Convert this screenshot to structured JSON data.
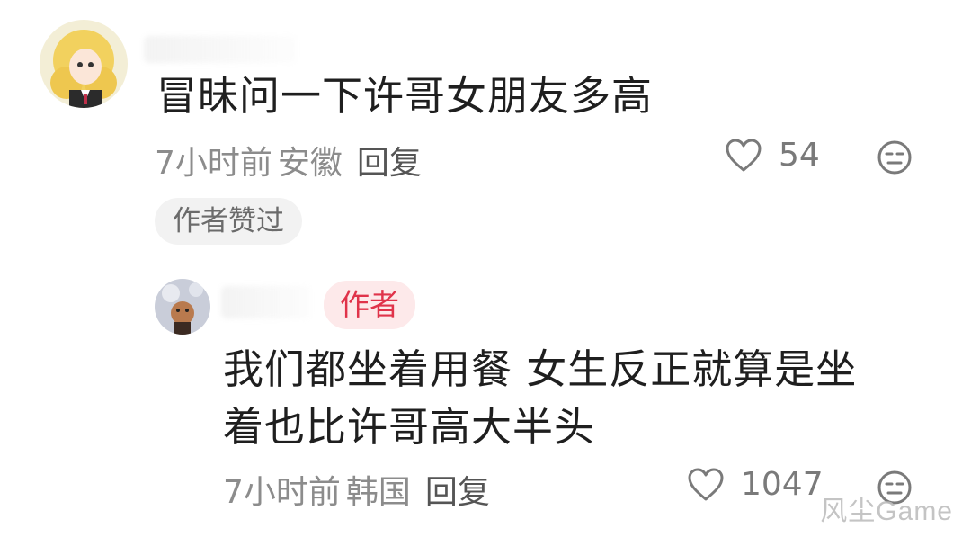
{
  "comments": [
    {
      "text": "冒昧问一下许哥女朋友多高",
      "time": "7小时前",
      "location": "安徽",
      "reply_label": "回复",
      "likes": "54",
      "liked_tag": "作者赞过"
    },
    {
      "author_badge": "作者",
      "text_line1": "我们都坐着用餐 女生反正就算是坐",
      "text_line2": "着也比许哥高大半头",
      "time": "7小时前",
      "location": "韩国",
      "reply_label": "回复",
      "likes": "1047"
    }
  ],
  "watermark": "风尘Game",
  "icons": {
    "like": "heart-icon",
    "dislike": "meh-face-icon"
  },
  "colors": {
    "author_badge_bg": "#fde9ea",
    "author_badge_text": "#e0334a",
    "meta_text": "#8c8c8c"
  }
}
